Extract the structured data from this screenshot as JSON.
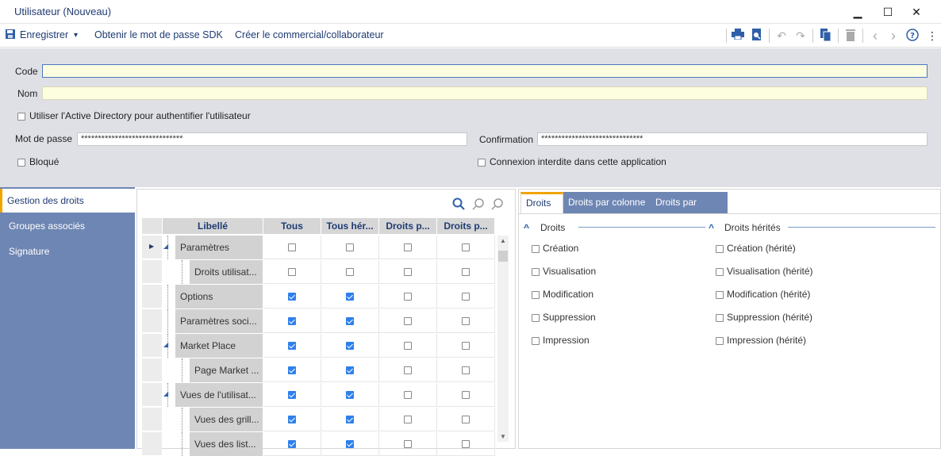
{
  "window": {
    "title": "Utilisateur (Nouveau)",
    "minimize": "▁",
    "maximize": "☐",
    "close": "✕"
  },
  "toolbar": {
    "save_label": "Enregistrer",
    "save_dropdown": "▾",
    "get_sdk_password": "Obtenir le mot de passe SDK",
    "create_salesperson": "Créer le commercial/collaborateur"
  },
  "form": {
    "code_label": "Code",
    "code_value": "",
    "name_label": "Nom",
    "name_value": "",
    "active_directory_label": "Utiliser l'Active Directory pour authentifier l'utilisateur",
    "password_label": "Mot de passe",
    "password_value": "******************************",
    "confirmation_label": "Confirmation",
    "confirmation_value": "******************************",
    "blocked_label": "Bloqué",
    "no_login_label": "Connexion interdite dans cette application"
  },
  "nav": {
    "items": [
      {
        "label": "Gestion des droits"
      },
      {
        "label": "Groupes associés"
      },
      {
        "label": "Signature"
      }
    ]
  },
  "grid": {
    "columns": [
      "Libellé",
      "Tous",
      "Tous hér...",
      "Droits p...",
      "Droits p..."
    ],
    "rows": [
      {
        "label": "Paramètres",
        "tous": false,
        "herites": false,
        "p1": false,
        "p2": false
      },
      {
        "label": "Droits utilisat...",
        "tous": false,
        "herites": false,
        "p1": false,
        "p2": false
      },
      {
        "label": "Options",
        "tous": true,
        "herites": true,
        "p1": false,
        "p2": false
      },
      {
        "label": "Paramètres soci...",
        "tous": true,
        "herites": true,
        "p1": false,
        "p2": false
      },
      {
        "label": "Market Place",
        "tous": true,
        "herites": true,
        "p1": false,
        "p2": false
      },
      {
        "label": "Page Market ...",
        "tous": true,
        "herites": true,
        "p1": false,
        "p2": false
      },
      {
        "label": "Vues de l'utilisat...",
        "tous": true,
        "herites": true,
        "p1": false,
        "p2": false
      },
      {
        "label": "Vues des grill...",
        "tous": true,
        "herites": true,
        "p1": false,
        "p2": false
      },
      {
        "label": "Vues des list...",
        "tous": true,
        "herites": true,
        "p1": false,
        "p2": false
      }
    ]
  },
  "rights": {
    "tabs": [
      "Droits",
      "Droits par colonne",
      "Droits par valeur"
    ],
    "droits_title": "Droits",
    "herites_title": "Droits hérités",
    "droits": [
      "Création",
      "Visualisation",
      "Modification",
      "Suppression",
      "Impression"
    ],
    "herites": [
      "Création (hérité)",
      "Visualisation (hérité)",
      "Modification (hérité)",
      "Suppression (hérité)",
      "Impression (hérité)"
    ]
  }
}
